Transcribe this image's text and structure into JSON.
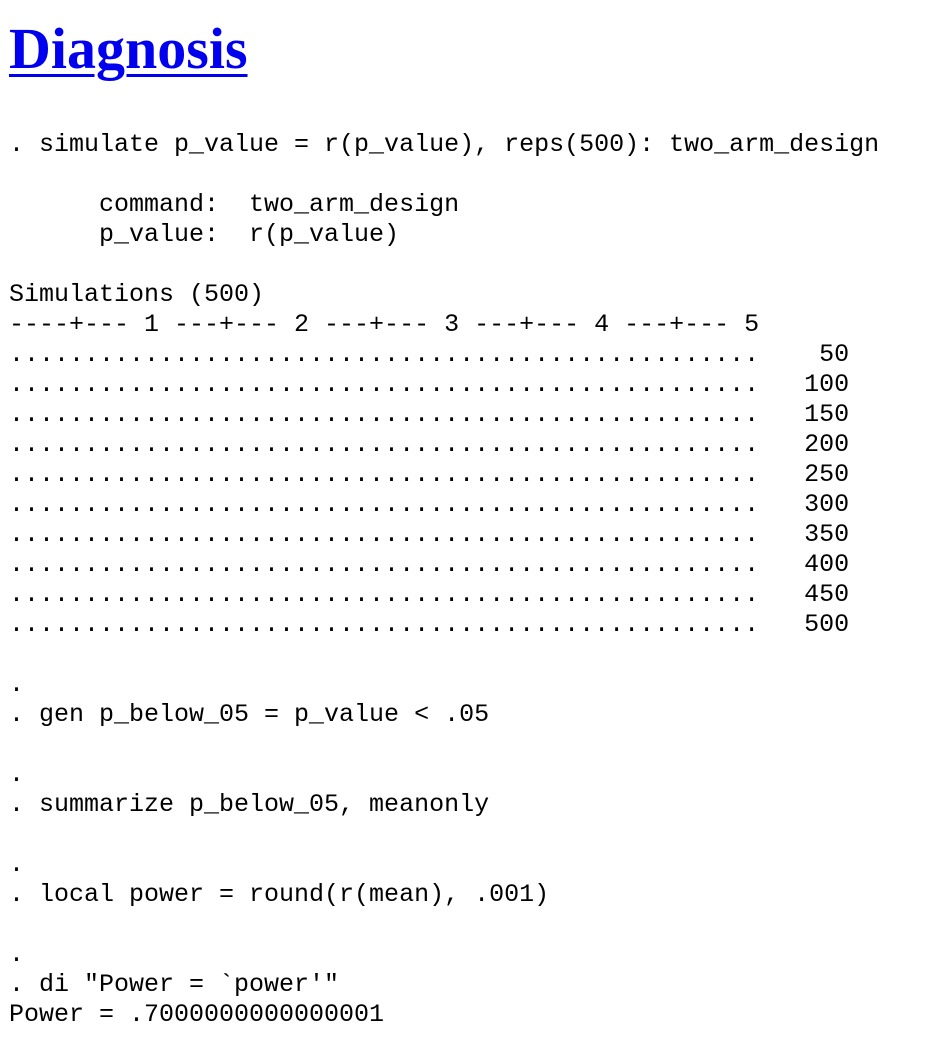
{
  "heading": {
    "text": "Diagnosis"
  },
  "log": {
    "lines": [
      ". simulate p_value = r(p_value), reps(500): two_arm_design",
      "",
      "      command:  two_arm_design",
      "      p_value:  r(p_value)",
      "",
      "Simulations (500)",
      "----+--- 1 ---+--- 2 ---+--- 3 ---+--- 4 ---+--- 5",
      "..................................................    50",
      "..................................................   100",
      "..................................................   150",
      "..................................................   200",
      "..................................................   250",
      "..................................................   300",
      "..................................................   350",
      "..................................................   400",
      "..................................................   450",
      "..................................................   500",
      "",
      ".",
      ". gen p_below_05 = p_value < .05",
      "",
      ".",
      ". summarize p_below_05, meanonly",
      "",
      ".",
      ". local power = round(r(mean), .001)",
      "",
      ".",
      ". di \"Power = `power'\"",
      "Power = .7000000000000001"
    ]
  }
}
